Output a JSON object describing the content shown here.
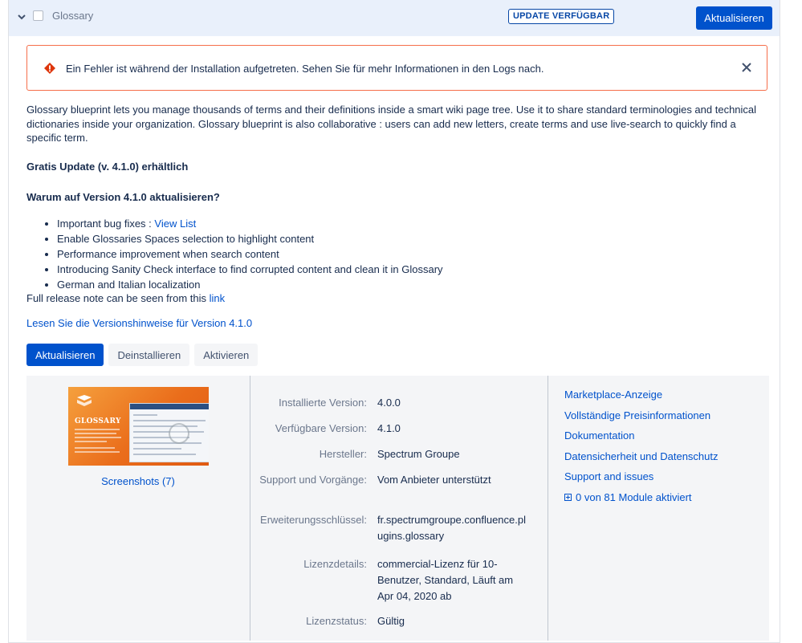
{
  "header": {
    "title": "Glossary",
    "badge": "UPDATE VERFÜGBAR",
    "update_button": "Aktualisieren"
  },
  "error": {
    "message": "Ein Fehler ist während der Installation aufgetreten. Sehen Sie für mehr Informationen in den Logs nach."
  },
  "description": "Glossary blueprint lets you manage thousands of terms and their definitions inside a smart wiki page tree. Use it to share standard terminologies and technical dictionaries inside your organization. Glossary blueprint is also collaborative : users can add new letters, create terms and use live-search to quickly find a specific term.",
  "update_heading": "Gratis Update (v. 4.1.0) erhältlich",
  "why_heading": "Warum auf Version 4.1.0 aktualisieren?",
  "bullets": [
    {
      "text": "Important bug fixes : ",
      "link": "View List"
    },
    {
      "text": "Enable Glossaries Spaces selection to highlight content"
    },
    {
      "text": "Performance improvement when search content"
    },
    {
      "text": "Introducing Sanity Check interface to find corrupted content and clean it in Glossary"
    },
    {
      "text": "German and Italian localization"
    }
  ],
  "release_note": {
    "text": "Full release note can be seen from this ",
    "link": "link"
  },
  "version_notes_link": "Lesen Sie die Versionshinweise für Version 4.1.0",
  "actions": {
    "update": "Aktualisieren",
    "uninstall": "Deinstallieren",
    "activate": "Aktivieren"
  },
  "thumbnail": {
    "title": "GLOSSARY"
  },
  "screenshots_link": "Screenshots (7)",
  "details": [
    {
      "label": "Installierte Version:",
      "value": "4.0.0"
    },
    {
      "label": "Verfügbare Version:",
      "value": "4.1.0"
    },
    {
      "label": "Hersteller:",
      "value": "Spectrum Groupe"
    },
    {
      "label": "Support und Vorgänge:",
      "value": "Vom Anbieter unterstützt"
    },
    {
      "label": "Erweiterungsschlüssel:",
      "value": "fr.spectrumgroupe.confluence.plugins.glossary"
    },
    {
      "label": "Lizenzdetails:",
      "value": "commercial-Lizenz für 10-Benutzer, Standard, Läuft am Apr 04, 2020 ab"
    },
    {
      "label": "Lizenzstatus:",
      "value": "Gültig"
    }
  ],
  "side_links": {
    "marketplace": "Marketplace-Anzeige",
    "pricing": "Vollständige Preisinformationen",
    "docs": "Dokumentation",
    "privacy": "Datensicherheit und Datenschutz",
    "support": "Support and issues",
    "modules": "0 von 81 Module aktiviert"
  }
}
